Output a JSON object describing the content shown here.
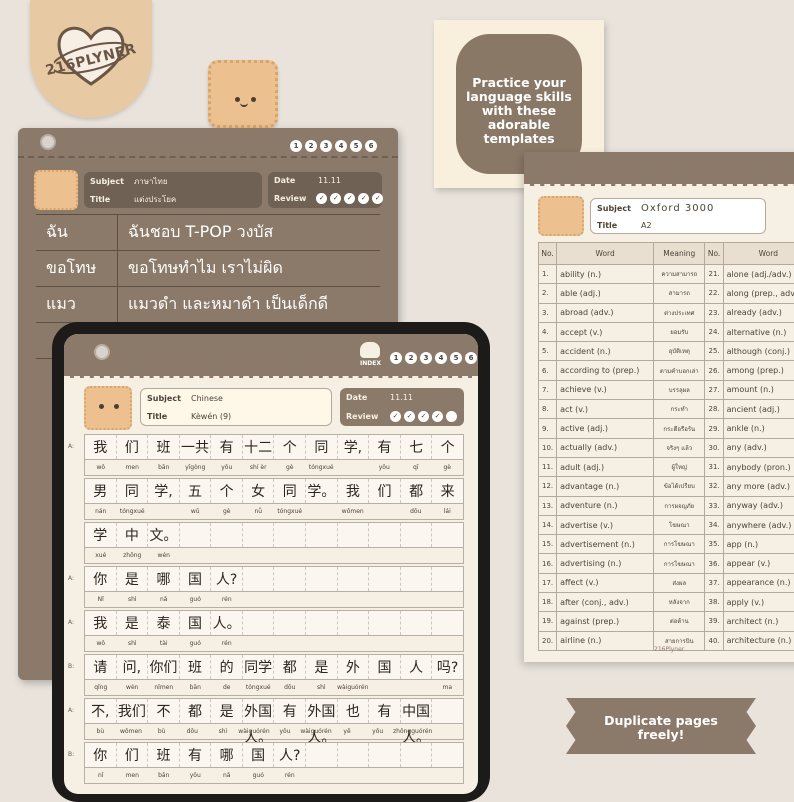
{
  "brand": {
    "name": "216PLYNER",
    "footer": "216Plyner"
  },
  "promo_note": {
    "line1": "Practice your",
    "line2": "language skills",
    "line3": "with these",
    "line4": "adorable",
    "line5": "templates"
  },
  "ribbon": {
    "line1": "Duplicate pages",
    "line2": "freely!"
  },
  "index": {
    "label": "INDEX",
    "tabs": [
      "1",
      "2",
      "3",
      "4",
      "5",
      "6"
    ]
  },
  "labels": {
    "subject": "Subject",
    "title": "Title",
    "date": "Date",
    "review": "Review"
  },
  "thai_page": {
    "subject": "ภาษาไทย",
    "title": "แต่งประโยค",
    "date": "11.11",
    "rows": [
      {
        "word": "ฉัน",
        "sentence": "ฉันชอบ T-POP วงบัส"
      },
      {
        "word": "ขอโทษ",
        "sentence": "ขอโทษทำไม เราไม่ผิด"
      },
      {
        "word": "แมว",
        "sentence": "แมวดำ และหมาดำ เป็นเด็กดี"
      }
    ]
  },
  "chinese_page": {
    "subject": "Chinese",
    "title": "Kèwén (9)",
    "date": "11.11",
    "rows": [
      {
        "label": "A:",
        "chars": [
          "我",
          "们",
          "班",
          "一共",
          "有",
          "十二",
          "个",
          "同",
          "学,",
          "有",
          "七",
          "个"
        ],
        "pinyin": [
          "wǒ",
          "men",
          "bān",
          "yīgòng",
          "yǒu",
          "shí èr",
          "gè",
          "tóngxué",
          "",
          "yǒu",
          "qī",
          "gè"
        ]
      },
      {
        "label": "",
        "chars": [
          "男",
          "同",
          "学,",
          "五",
          "个",
          "女",
          "同",
          "学。",
          "我",
          "们",
          "都",
          "来"
        ],
        "pinyin": [
          "nán",
          "tóngxué",
          "",
          "wǔ",
          "gè",
          "nǚ",
          "tóngxué",
          "",
          "wǒmen",
          "",
          "dōu",
          "lái"
        ]
      },
      {
        "label": "",
        "chars": [
          "学",
          "中",
          "文。",
          "",
          "",
          "",
          "",
          "",
          "",
          "",
          "",
          ""
        ],
        "pinyin": [
          "xué",
          "zhōng",
          "wén",
          "",
          "",
          "",
          "",
          "",
          "",
          "",
          "",
          ""
        ]
      },
      {
        "label": "A:",
        "chars": [
          "你",
          "是",
          "哪",
          "国",
          "人?",
          "",
          "",
          "",
          "",
          "",
          "",
          ""
        ],
        "pinyin": [
          "Nǐ",
          "shì",
          "nǎ",
          "guó",
          "rén",
          "",
          "",
          "",
          "",
          "",
          "",
          ""
        ]
      },
      {
        "label": "A:",
        "chars": [
          "我",
          "是",
          "泰",
          "国",
          "人。",
          "",
          "",
          "",
          "",
          "",
          "",
          ""
        ],
        "pinyin": [
          "wǒ",
          "shì",
          "tài",
          "guó",
          "rén",
          "",
          "",
          "",
          "",
          "",
          "",
          ""
        ]
      },
      {
        "label": "B:",
        "chars": [
          "请",
          "问,",
          "你们",
          "班",
          "的",
          "同学",
          "都",
          "是",
          "外",
          "国",
          "人",
          "吗?"
        ],
        "pinyin": [
          "qǐng",
          "wèn",
          "nǐmen",
          "bān",
          "de",
          "tóngxué",
          "dōu",
          "shì",
          "wàiguórén",
          "",
          "",
          "ma"
        ]
      },
      {
        "label": "A:",
        "chars": [
          "不,",
          "我们",
          "不",
          "都",
          "是",
          "外国人。",
          "有",
          "外国人。",
          "也",
          "有",
          "中国人。",
          ""
        ],
        "pinyin": [
          "bù",
          "wǒmen",
          "bù",
          "dōu",
          "shì",
          "wàiguórén",
          "yǒu",
          "wàiguórén",
          "yě",
          "yǒu",
          "zhōngguórén",
          ""
        ]
      },
      {
        "label": "B:",
        "chars": [
          "你",
          "们",
          "班",
          "有",
          "哪",
          "国",
          "人?",
          "",
          "",
          "",
          "",
          ""
        ],
        "pinyin": [
          "nǐ",
          "men",
          "bān",
          "yǒu",
          "nǎ",
          "guó",
          "rén",
          "",
          "",
          "",
          "",
          ""
        ]
      }
    ]
  },
  "vocab_page": {
    "subject": "Oxford 3000",
    "title": "A2",
    "headers": {
      "no": "No.",
      "word": "Word",
      "meaning": "Meaning"
    },
    "rows": [
      {
        "no": "1.",
        "word": "ability (n.)",
        "meaning": "ความสามารถ",
        "no2": "21.",
        "word2": "alone (adj./adv.)"
      },
      {
        "no": "2.",
        "word": "able (adj.)",
        "meaning": "สามารถ",
        "no2": "22.",
        "word2": "along (prep., adv.)"
      },
      {
        "no": "3.",
        "word": "abroad (adv.)",
        "meaning": "ต่างประเทศ",
        "no2": "23.",
        "word2": "already (adv.)"
      },
      {
        "no": "4.",
        "word": "accept (v.)",
        "meaning": "ยอมรับ",
        "no2": "24.",
        "word2": "alternative (n.)"
      },
      {
        "no": "5.",
        "word": "accident (n.)",
        "meaning": "อุบัติเหตุ",
        "no2": "25.",
        "word2": "although (conj.)"
      },
      {
        "no": "6.",
        "word": "according to (prep.)",
        "meaning": "ตามคำบอกเล่า",
        "no2": "26.",
        "word2": "among (prep.)"
      },
      {
        "no": "7.",
        "word": "achieve (v.)",
        "meaning": "บรรลุผล",
        "no2": "27.",
        "word2": "amount (n.)"
      },
      {
        "no": "8.",
        "word": "act (v.)",
        "meaning": "กระทำ",
        "no2": "28.",
        "word2": "ancient (adj.)"
      },
      {
        "no": "9.",
        "word": "active (adj.)",
        "meaning": "กระตือรือร้น",
        "no2": "29.",
        "word2": "ankle (n.)"
      },
      {
        "no": "10.",
        "word": "actually (adv.)",
        "meaning": "จริงๆ แล้ว",
        "no2": "30.",
        "word2": "any (adv.)"
      },
      {
        "no": "11.",
        "word": "adult (adj.)",
        "meaning": "ผู้ใหญ่",
        "no2": "31.",
        "word2": "anybody (pron.)"
      },
      {
        "no": "12.",
        "word": "advantage (n.)",
        "meaning": "ข้อได้เปรียบ",
        "no2": "32.",
        "word2": "any more (adv.)"
      },
      {
        "no": "13.",
        "word": "adventure (n.)",
        "meaning": "การผจญภัย",
        "no2": "33.",
        "word2": "anyway (adv.)"
      },
      {
        "no": "14.",
        "word": "advertise (v.)",
        "meaning": "โฆษณา",
        "no2": "34.",
        "word2": "anywhere (adv.)"
      },
      {
        "no": "15.",
        "word": "advertisement (n.)",
        "meaning": "การโฆษณา",
        "no2": "35.",
        "word2": "app (n.)"
      },
      {
        "no": "16.",
        "word": "advertising (n.)",
        "meaning": "การโฆษณา",
        "no2": "36.",
        "word2": "appear (v.)"
      },
      {
        "no": "17.",
        "word": "affect (v.)",
        "meaning": "ส่งผล",
        "no2": "37.",
        "word2": "appearance (n.)"
      },
      {
        "no": "18.",
        "word": "after (conj., adv.)",
        "meaning": "หลังจาก",
        "no2": "38.",
        "word2": "apply (v.)"
      },
      {
        "no": "19.",
        "word": "against (prep.)",
        "meaning": "ต่อต้าน",
        "no2": "39.",
        "word2": "architect (n.)"
      },
      {
        "no": "20.",
        "word": "airline (n.)",
        "meaning": "สายการบิน",
        "no2": "40.",
        "word2": "architecture (n.)"
      }
    ]
  }
}
